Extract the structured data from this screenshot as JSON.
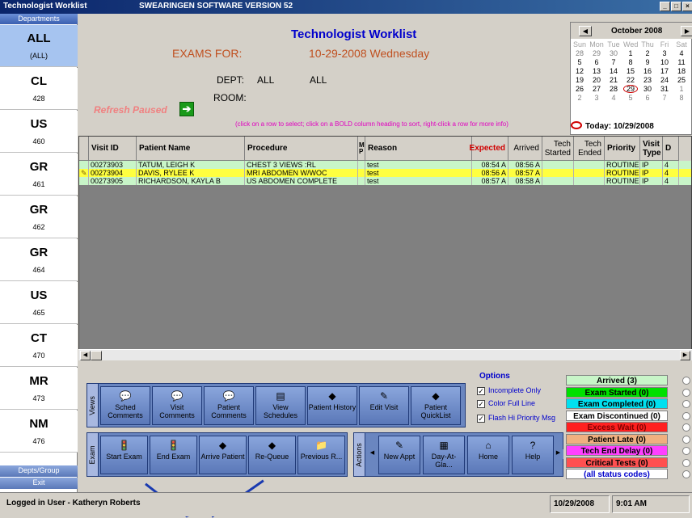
{
  "window": {
    "title": "Technologist Worklist",
    "software": "SWEARINGEN SOFTWARE VERSION 52"
  },
  "sidebar": {
    "header": "Departments",
    "items": [
      {
        "code": "ALL",
        "count": "(ALL)"
      },
      {
        "code": "CL",
        "count": "428"
      },
      {
        "code": "US",
        "count": "460"
      },
      {
        "code": "GR",
        "count": "461"
      },
      {
        "code": "GR",
        "count": "462"
      },
      {
        "code": "GR",
        "count": "464"
      },
      {
        "code": "US",
        "count": "465"
      },
      {
        "code": "CT",
        "count": "470"
      },
      {
        "code": "MR",
        "count": "473"
      },
      {
        "code": "NM",
        "count": "476"
      }
    ],
    "footer1": "Depts/Group",
    "footer2": "Exit"
  },
  "header": {
    "title": "Technologist Worklist",
    "exams_for": "EXAMS FOR:",
    "date": "10-29-2008  Wednesday",
    "dept_label": "DEPT:",
    "dept_value1": "ALL",
    "dept_value2": "ALL",
    "room_label": "ROOM:",
    "refresh": "Refresh Paused",
    "hint": "(click on a row to select; click on a BOLD column heading to sort, right-click a row for more info)"
  },
  "calendar": {
    "month": "October 2008",
    "dow": [
      "Sun",
      "Mon",
      "Tue",
      "Wed",
      "Thu",
      "Fri",
      "Sat"
    ],
    "weeks": [
      [
        "28",
        "29",
        "30",
        "1",
        "2",
        "3",
        "4"
      ],
      [
        "5",
        "6",
        "7",
        "8",
        "9",
        "10",
        "11"
      ],
      [
        "12",
        "13",
        "14",
        "15",
        "16",
        "17",
        "18"
      ],
      [
        "19",
        "20",
        "21",
        "22",
        "23",
        "24",
        "25"
      ],
      [
        "26",
        "27",
        "28",
        "29",
        "30",
        "31",
        "1"
      ],
      [
        "2",
        "3",
        "4",
        "5",
        "6",
        "7",
        "8"
      ]
    ],
    "today": "Today: 10/29/2008"
  },
  "grid": {
    "columns": [
      "Visit ID",
      "Patient Name",
      "Procedure",
      "M P",
      "Reason",
      "Expected",
      "Arrived",
      "Tech Started",
      "Tech Ended",
      "Priority",
      "Visit Type",
      "D"
    ],
    "rows": [
      {
        "visit_id": "00273903",
        "patient": "TATUM, LEIGH K",
        "procedure": "CHEST 3 VIEWS :RL",
        "reason": "test",
        "expected": "08:54 A",
        "arrived": "08:56 A",
        "priority": "ROUTINE",
        "type": "IP",
        "d": "4",
        "color": "#c8f5c8"
      },
      {
        "visit_id": "00273904",
        "patient": "DAVIS, RYLEE K",
        "procedure": "MRI ABDOMEN W/WOC",
        "reason": "test",
        "expected": "08:56 A",
        "arrived": "08:57 A",
        "priority": "ROUTINE",
        "type": "IP",
        "d": "4",
        "color": "#ffff40"
      },
      {
        "visit_id": "00273905",
        "patient": "RICHARDSON, KAYLA B",
        "procedure": "US ABDOMEN COMPLETE",
        "reason": "test",
        "expected": "08:57 A",
        "arrived": "08:58 A",
        "priority": "ROUTINE",
        "type": "IP",
        "d": "4",
        "color": "#c8f5c8"
      }
    ]
  },
  "views_toolbar": {
    "label": "Views",
    "buttons": [
      "Sched Comments",
      "Visit Comments",
      "Patient Comments",
      "View Schedules",
      "Patient History",
      "Edit Visit",
      "Patient QuickList"
    ]
  },
  "exam_toolbar": {
    "label": "Exam",
    "buttons": [
      "Start Exam",
      "End Exam",
      "Arrive Patient",
      "Re-Queue",
      "Previous R..."
    ]
  },
  "actions_toolbar": {
    "label": "Actions",
    "buttons": [
      "New Appt",
      "Day-At-Gla...",
      "Home",
      "Help"
    ]
  },
  "options": {
    "title": "Options",
    "items": [
      "Incomplete Only",
      "Color Full Line",
      "Flash Hi Priority Msg"
    ]
  },
  "statuses": [
    {
      "label": "Arrived (3)",
      "bg": "#c8f5c8",
      "fg": "#000000"
    },
    {
      "label": "Exam Started (0)",
      "bg": "#00e000",
      "fg": "#000000"
    },
    {
      "label": "Exam Completed (0)",
      "bg": "#00e0f0",
      "fg": "#000000"
    },
    {
      "label": "Exam Discontinued (0)",
      "bg": "#ffffff",
      "fg": "#000000"
    },
    {
      "label": "Excess Wait (0)",
      "bg": "#ff2020",
      "fg": "#800000"
    },
    {
      "label": "Patient Late (0)",
      "bg": "#f0b080",
      "fg": "#000000"
    },
    {
      "label": "Tech End Delay (0)",
      "bg": "#ff40ff",
      "fg": "#000000"
    },
    {
      "label": "Critical Tests (0)",
      "bg": "#ff5050",
      "fg": "#000000"
    },
    {
      "label": "(all status codes)",
      "bg": "#ffffff",
      "fg": "#0000cc"
    }
  ],
  "statusbar": {
    "user": "Logged in User - Katheryn  Roberts",
    "date": "10/29/2008",
    "time": "9:01 AM"
  }
}
